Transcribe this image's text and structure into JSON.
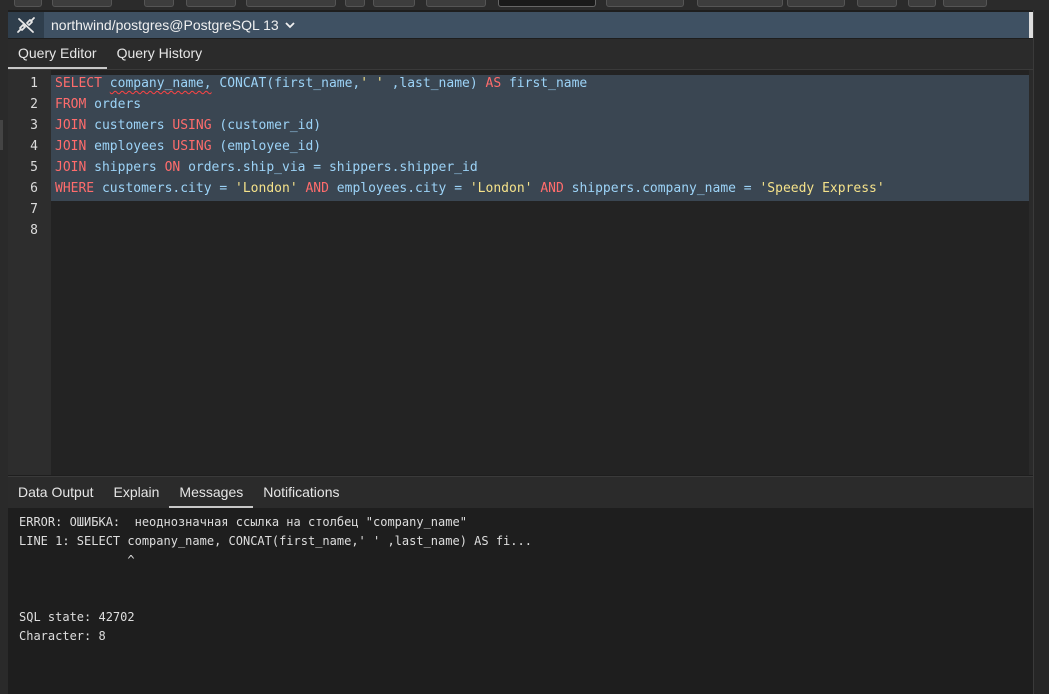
{
  "connection": {
    "label": "northwind/postgres@PostgreSQL 13"
  },
  "editor_tabs": [
    {
      "label": "Query Editor",
      "active": true
    },
    {
      "label": "Query History",
      "active": false
    }
  ],
  "editor": {
    "line_numbers": [
      "1",
      "2",
      "3",
      "4",
      "5",
      "6",
      "7",
      "8"
    ],
    "lines": [
      [
        {
          "t": "SELECT",
          "c": "kw"
        },
        {
          "t": " ",
          "c": ""
        },
        {
          "t": "company_name,",
          "c": "id sq"
        },
        {
          "t": " CONCAT(first_name,",
          "c": "id"
        },
        {
          "t": "' '",
          "c": "str"
        },
        {
          "t": " ,last_name) ",
          "c": "id"
        },
        {
          "t": "AS",
          "c": "kw"
        },
        {
          "t": " first_name",
          "c": "id"
        }
      ],
      [
        {
          "t": "FROM",
          "c": "kw"
        },
        {
          "t": " orders",
          "c": "id"
        }
      ],
      [
        {
          "t": "JOIN",
          "c": "kw"
        },
        {
          "t": " customers ",
          "c": "id"
        },
        {
          "t": "USING",
          "c": "kw"
        },
        {
          "t": " (customer_id)",
          "c": "id"
        }
      ],
      [
        {
          "t": "JOIN",
          "c": "kw"
        },
        {
          "t": " employees ",
          "c": "id"
        },
        {
          "t": "USING",
          "c": "kw"
        },
        {
          "t": " (employee_id)",
          "c": "id"
        }
      ],
      [
        {
          "t": "JOIN",
          "c": "kw"
        },
        {
          "t": " shippers ",
          "c": "id"
        },
        {
          "t": "ON",
          "c": "kw"
        },
        {
          "t": " orders.ship_via = shippers.shipper_id",
          "c": "id"
        }
      ],
      [
        {
          "t": "WHERE",
          "c": "kw"
        },
        {
          "t": " customers.city = ",
          "c": "id"
        },
        {
          "t": "'London'",
          "c": "str"
        },
        {
          "t": " ",
          "c": ""
        },
        {
          "t": "AND",
          "c": "kw"
        },
        {
          "t": " employees.city = ",
          "c": "id"
        },
        {
          "t": "'London'",
          "c": "str"
        },
        {
          "t": " ",
          "c": ""
        },
        {
          "t": "AND",
          "c": "kw"
        },
        {
          "t": " shippers.company_name = ",
          "c": "id"
        },
        {
          "t": "'Speedy Express'",
          "c": "str"
        }
      ],
      [],
      []
    ]
  },
  "result_tabs": [
    {
      "label": "Data Output",
      "active": false
    },
    {
      "label": "Explain",
      "active": false
    },
    {
      "label": "Messages",
      "active": true
    },
    {
      "label": "Notifications",
      "active": false
    }
  ],
  "messages": [
    "ERROR: ОШИБКА:  неоднозначная ссылка на столбец \"company_name\"",
    "LINE 1: SELECT company_name, CONCAT(first_name,' ' ,last_name) AS fi...",
    "               ^",
    "",
    "",
    "SQL state: 42702",
    "Character: 8"
  ],
  "colors": {
    "keyword": "#ff6c6c",
    "identifier": "#9cd3f7",
    "string": "#f5e28a",
    "selection": "#3a4652",
    "connection_bar": "#3f5163"
  },
  "icons": {
    "connection": "plug-disconnect-icon",
    "dropdown": "chevron-down-icon"
  }
}
